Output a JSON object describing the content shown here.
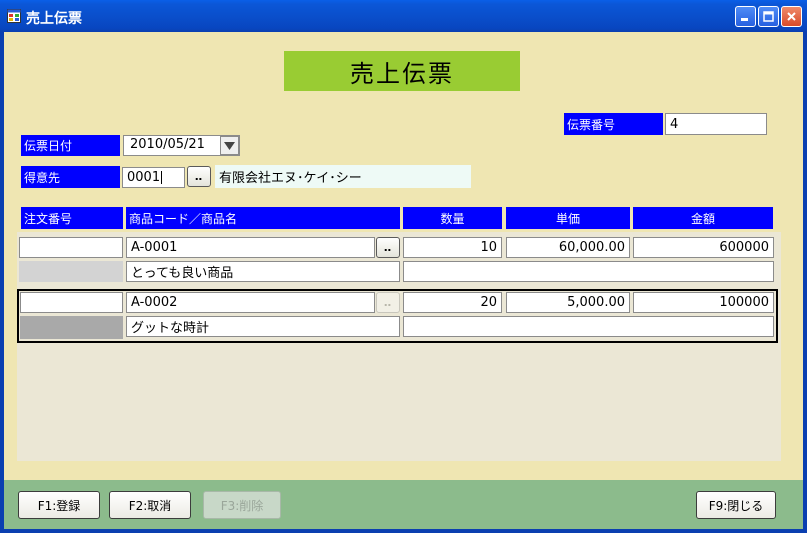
{
  "window": {
    "title": "売上伝票"
  },
  "form": {
    "heading": "売上伝票",
    "slip_number_label": "伝票番号",
    "slip_number_value": "4",
    "slip_date_label": "伝票日付",
    "slip_date_value": "2010/05/21",
    "customer_label": "得意先",
    "customer_code": "0001",
    "customer_name": "有限会社エヌ･ケイ･シー",
    "lookup_label": "‥"
  },
  "grid": {
    "headers": {
      "order_no": "注文番号",
      "product": "商品コード／商品名",
      "qty": "数量",
      "unit_price": "単価",
      "amount": "金額"
    },
    "rows": [
      {
        "order_no": "",
        "product_code": "A-0001",
        "product_name": "とっても良い商品",
        "qty": "10",
        "unit_price": "60,000.00",
        "amount": "600000",
        "note": ""
      },
      {
        "order_no": "",
        "product_code": "A-0002",
        "product_name": "グットな時計",
        "qty": "20",
        "unit_price": "5,000.00",
        "amount": "100000",
        "note": ""
      }
    ]
  },
  "footer": {
    "f1": "F1:登録",
    "f2": "F2:取消",
    "f3": "F3:削除",
    "f9": "F9:閉じる"
  },
  "colors": {
    "titlebar": "#0a4fcc",
    "form_bg": "#efe6b2",
    "heading_bg": "#99cc33",
    "label_bg": "#0000ff",
    "footer_bg": "#8cbb8c"
  },
  "icons": [
    "app-icon",
    "minimize-icon",
    "maximize-icon",
    "close-icon",
    "dropdown-arrow-icon"
  ]
}
